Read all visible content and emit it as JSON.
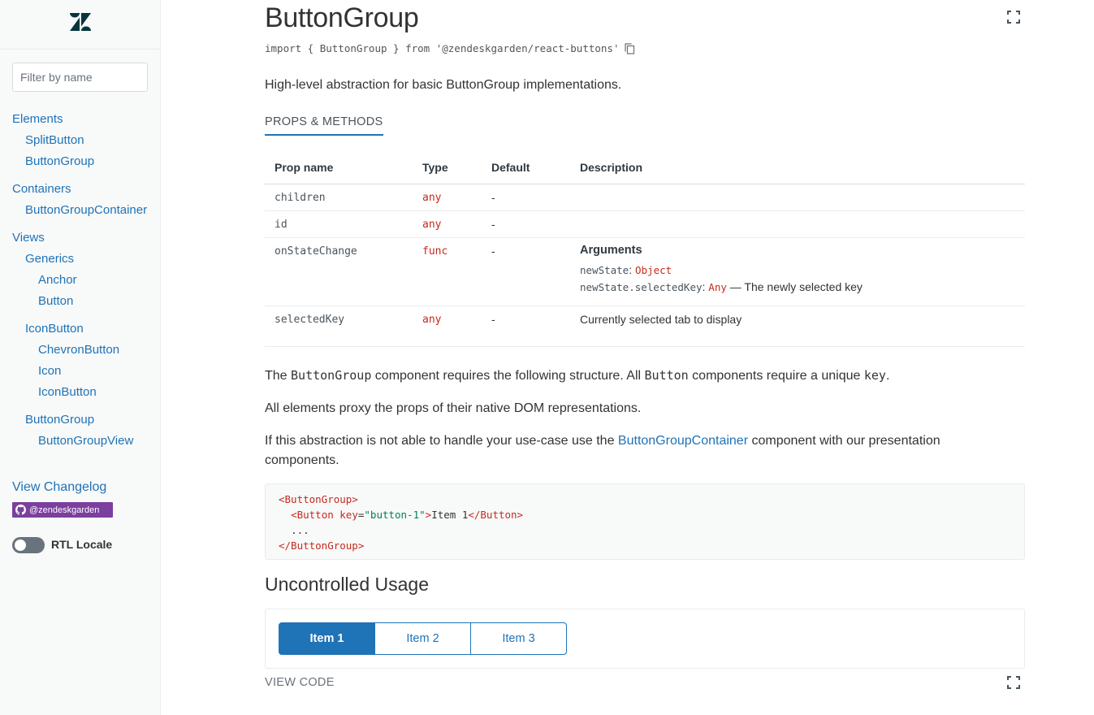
{
  "sidebar": {
    "filter_placeholder": "Filter by name",
    "nav": [
      {
        "label": "Elements"
      },
      {
        "label": "SplitButton"
      },
      {
        "label": "ButtonGroup"
      },
      {
        "label": "Containers"
      },
      {
        "label": "ButtonGroupContainer"
      },
      {
        "label": "Views"
      },
      {
        "label": "Generics"
      },
      {
        "label": "Anchor"
      },
      {
        "label": "Button"
      },
      {
        "label": "IconButton"
      },
      {
        "label": "ChevronButton"
      },
      {
        "label": "Icon"
      },
      {
        "label": "IconButton"
      },
      {
        "label": "ButtonGroup"
      },
      {
        "label": "ButtonGroupView"
      }
    ],
    "changelog": "View Changelog",
    "github_badge": "@zendeskgarden",
    "rtl_label": "RTL Locale"
  },
  "main": {
    "title": "ButtonGroup",
    "import_line": "import { ButtonGroup } from '@zendeskgarden/react-buttons'",
    "lead": "High-level abstraction for basic ButtonGroup implementations.",
    "tab": "PROPS & METHODS",
    "table": {
      "headers": [
        "Prop name",
        "Type",
        "Default",
        "Description"
      ],
      "rows": [
        {
          "name": "children",
          "type": "any",
          "default": "-",
          "description": ""
        },
        {
          "name": "id",
          "type": "any",
          "default": "-",
          "description": ""
        },
        {
          "name": "onStateChange",
          "type": "func",
          "default": "-",
          "description": ""
        },
        {
          "name": "selectedKey",
          "type": "any",
          "default": "-",
          "description": "Currently selected tab to display"
        }
      ],
      "args": {
        "title": "Arguments",
        "arg1_name": "newState",
        "arg1_type": "Object",
        "arg2_name": "newState.selectedKey",
        "arg2_type": "Any",
        "arg2_desc": "— The newly selected key"
      }
    },
    "para1": {
      "pre": "The ",
      "code1": "ButtonGroup",
      "mid": " component requires the following structure. All ",
      "code2": "Button",
      "mid2": " components require a unique ",
      "code3": "key",
      "end": "."
    },
    "para2": "All elements proxy the props of their native DOM representations.",
    "para3": {
      "pre": "If this abstraction is not able to handle your use-case use the ",
      "link": "ButtonGroupContainer",
      "post": " component with our presentation components."
    },
    "code": {
      "line1": "<ButtonGroup>",
      "line2_open": "<Button",
      "line2_attr": "key",
      "line2_val": "\"button-1\"",
      "line2_text": "Item 1",
      "line2_close": "</Button>",
      "line3": "...",
      "line4": "</ButtonGroup>"
    },
    "section_title": "Uncontrolled Usage",
    "demo_buttons": [
      {
        "label": "Item 1",
        "selected": true
      },
      {
        "label": "Item 2",
        "selected": false
      },
      {
        "label": "Item 3",
        "selected": false
      }
    ],
    "view_code": "VIEW CODE"
  },
  "colors": {
    "accent": "#1f73b7",
    "type_red": "#c72a1c",
    "badge_purple": "#7b3f9e"
  },
  "icons": [
    "zendesk-logo-icon",
    "expand-icon",
    "copy-icon",
    "github-icon"
  ]
}
